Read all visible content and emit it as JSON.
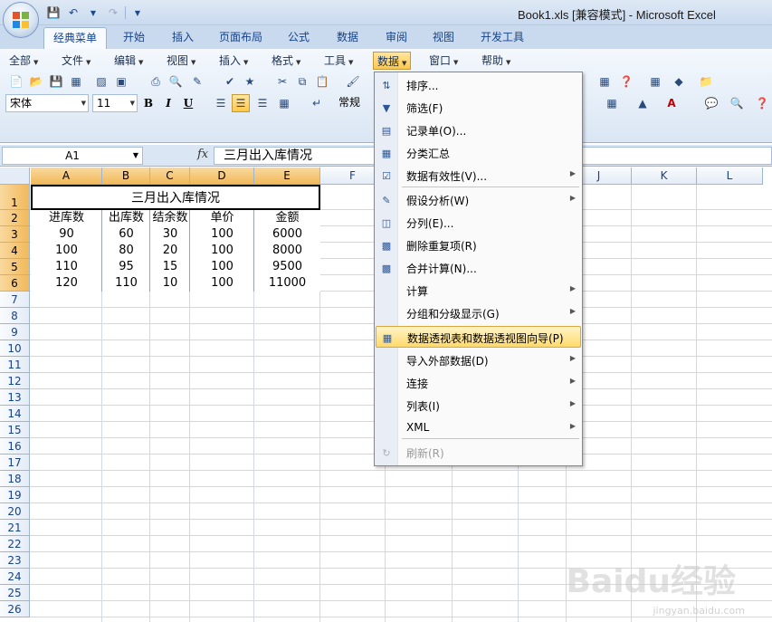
{
  "window": {
    "title": "Book1.xls  [兼容模式] - Microsoft Excel"
  },
  "ribbon_tabs": [
    "经典菜单",
    "开始",
    "插入",
    "页面布局",
    "公式",
    "数据",
    "审阅",
    "视图",
    "开发工具"
  ],
  "active_tab": "经典菜单",
  "menubar": [
    "全部",
    "文件",
    "编辑",
    "视图",
    "插入",
    "格式",
    "工具",
    "数据",
    "窗口",
    "帮助"
  ],
  "open_menu": "数据",
  "toolbar": {
    "font": "宋体",
    "size": "11",
    "number_format": "常规",
    "bold": "B",
    "italic": "I",
    "underline": "U"
  },
  "formula_bar": {
    "name_box": "A1",
    "fx": "fx",
    "content": "三月出入库情况"
  },
  "columns": [
    "A",
    "B",
    "C",
    "D",
    "E",
    "F",
    "J",
    "K",
    "L"
  ],
  "rows": [
    "1",
    "2",
    "3",
    "4",
    "5",
    "6",
    "7",
    "8",
    "9",
    "10",
    "11",
    "12",
    "13",
    "14",
    "15",
    "16",
    "17",
    "18",
    "19",
    "20",
    "21",
    "22",
    "23",
    "24",
    "25",
    "26"
  ],
  "sheet": {
    "title": "三月出入库情况",
    "headers": [
      "进库数",
      "出库数",
      "结余数",
      "单价",
      "金额"
    ],
    "data": [
      [
        "90",
        "60",
        "30",
        "100",
        "6000"
      ],
      [
        "100",
        "80",
        "20",
        "100",
        "8000"
      ],
      [
        "110",
        "95",
        "15",
        "100",
        "9500"
      ],
      [
        "120",
        "110",
        "10",
        "100",
        "11000"
      ]
    ]
  },
  "dropdown": [
    {
      "label": "排序...",
      "icon": "sort-icon",
      "submenu": false
    },
    {
      "label": "筛选(F)",
      "icon": "filter-icon",
      "submenu": false
    },
    {
      "label": "记录单(O)...",
      "icon": "form-icon",
      "submenu": false
    },
    {
      "label": "分类汇总",
      "icon": "subtotal-icon",
      "submenu": false
    },
    {
      "label": "数据有效性(V)...",
      "icon": "validation-icon",
      "submenu": true
    },
    {
      "label": "假设分析(W)",
      "icon": "whatif-icon",
      "submenu": true
    },
    {
      "label": "分列(E)...",
      "icon": "text-to-columns-icon",
      "submenu": false
    },
    {
      "label": "删除重复项(R)",
      "icon": "remove-duplicates-icon",
      "submenu": false
    },
    {
      "label": "合并计算(N)...",
      "icon": "consolidate-icon",
      "submenu": false
    },
    {
      "label": "计算",
      "icon": "",
      "submenu": true
    },
    {
      "label": "分组和分级显示(G)",
      "icon": "",
      "submenu": true
    },
    {
      "label": "数据透视表和数据透视图向导(P)",
      "icon": "pivot-wizard-icon",
      "submenu": false
    },
    {
      "label": "导入外部数据(D)",
      "icon": "",
      "submenu": true
    },
    {
      "label": "连接",
      "icon": "",
      "submenu": true
    },
    {
      "label": "列表(I)",
      "icon": "",
      "submenu": true
    },
    {
      "label": "XML",
      "icon": "",
      "submenu": true
    },
    {
      "label": "刷新(R)",
      "icon": "refresh-icon",
      "submenu": false,
      "disabled": true
    }
  ],
  "highlighted_item": "数据透视表和数据透视图向导(P)",
  "watermark": {
    "text": "Baidu经验",
    "sub": "jingyan.baidu.com"
  }
}
